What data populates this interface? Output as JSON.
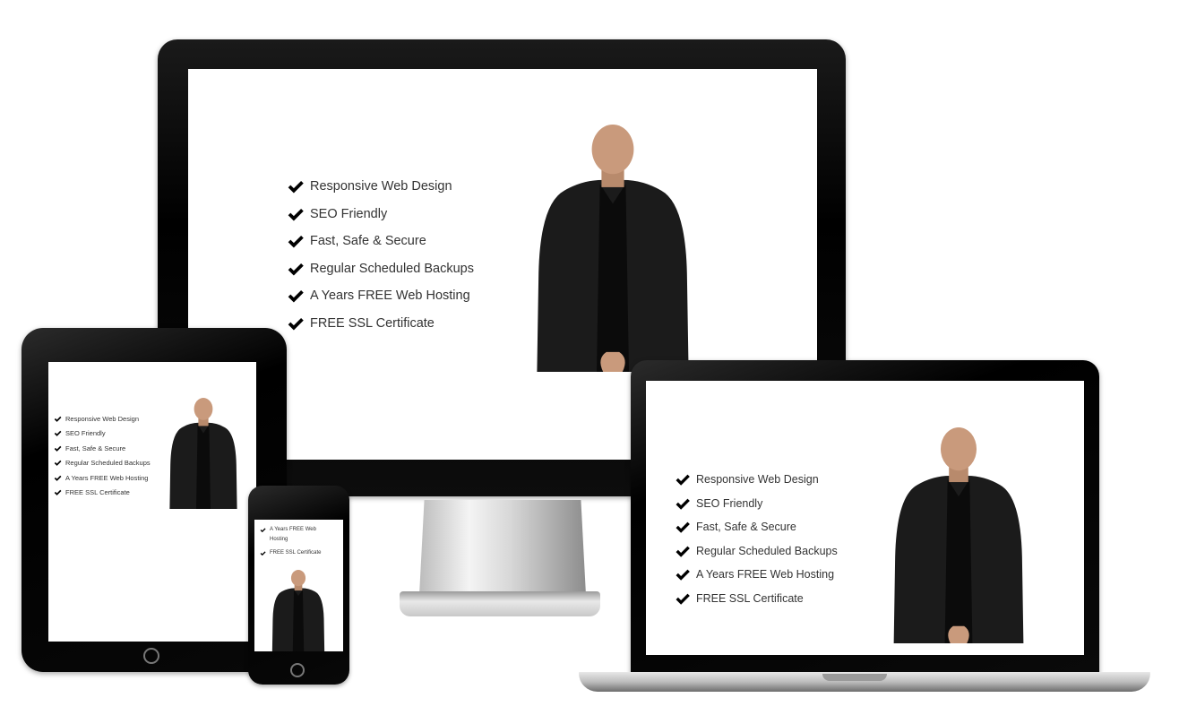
{
  "features": [
    "Responsive Web Design",
    "SEO Friendly",
    "Fast, Safe & Secure",
    "Regular Scheduled Backups",
    "A Years FREE Web Hosting",
    "FREE SSL Certificate"
  ],
  "phone_features": [
    "A Years FREE Web Hosting",
    "FREE SSL Certificate"
  ],
  "colors": {
    "text": "#333333",
    "check": "#000000",
    "device_bezel": "#000000",
    "jacket": "#1b1b1b",
    "skin": "#c99a7c"
  },
  "icons": [
    "check-icon",
    "home-button-icon"
  ]
}
